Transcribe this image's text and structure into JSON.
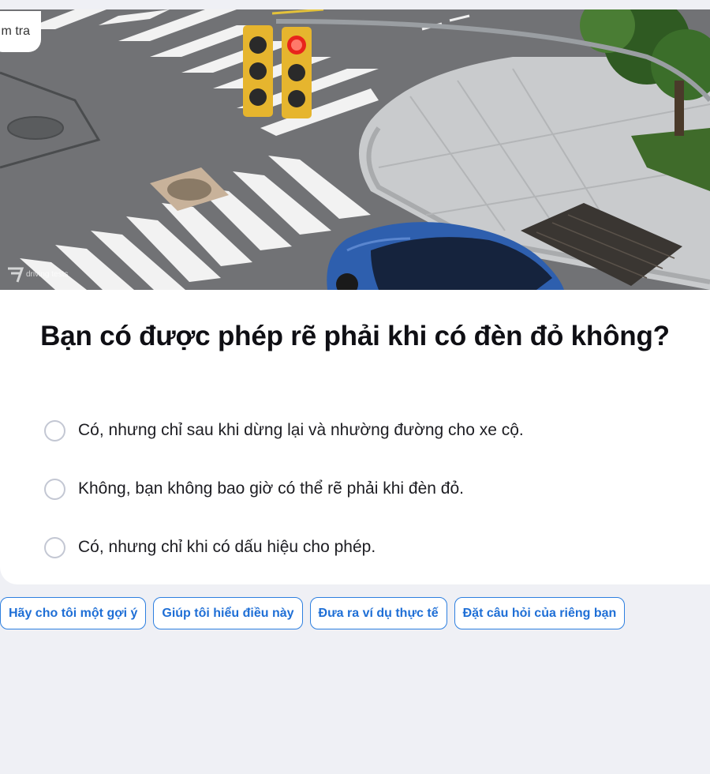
{
  "hero": {
    "tag": "m tra",
    "watermark": "driving tests"
  },
  "question": "Bạn có được phép rẽ phải khi có đèn đỏ không?",
  "options": [
    "Có, nhưng chỉ sau khi dừng lại và nhường đường cho xe cộ.",
    "Không, bạn không bao giờ có thể rẽ phải khi đèn đỏ.",
    "Có, nhưng chỉ khi có dấu hiệu cho phép."
  ],
  "chips": [
    "Hãy cho tôi một gợi ý",
    "Giúp tôi hiểu điều này",
    "Đưa ra ví dụ thực tế",
    "Đặt câu hỏi của riêng bạn"
  ],
  "colors": {
    "accent": "#2d7fe0",
    "background": "#eff0f5",
    "card": "#ffffff",
    "radio_border": "#c3c7d3"
  }
}
